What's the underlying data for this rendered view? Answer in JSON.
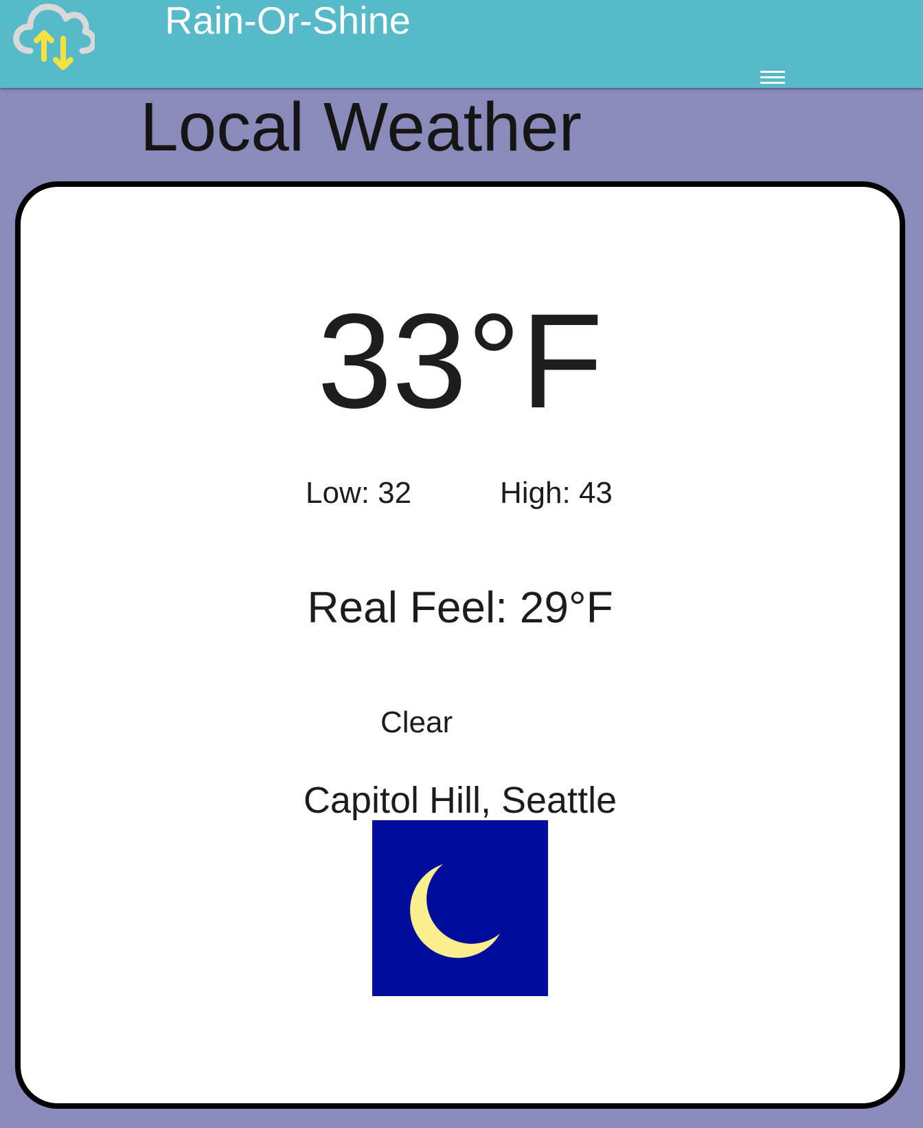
{
  "header": {
    "app_title": "Rain-Or-Shine",
    "logo_icon": "cloud-sync-icon",
    "menu_icon": "hamburger-menu-icon",
    "bar_color": "#57bac9"
  },
  "page": {
    "title": "Local Weather",
    "background_color": "#8a8bba"
  },
  "weather": {
    "temperature": "33",
    "unit": "°F",
    "low": "Low: 32",
    "high": "High: 43",
    "real_feel": "Real Feel: 29°F",
    "condition": "Clear",
    "location": "Capitol Hill, Seattle",
    "icon": "crescent-moon-icon",
    "icon_background": "#000c9a",
    "moon_color": "#fbee8f"
  }
}
